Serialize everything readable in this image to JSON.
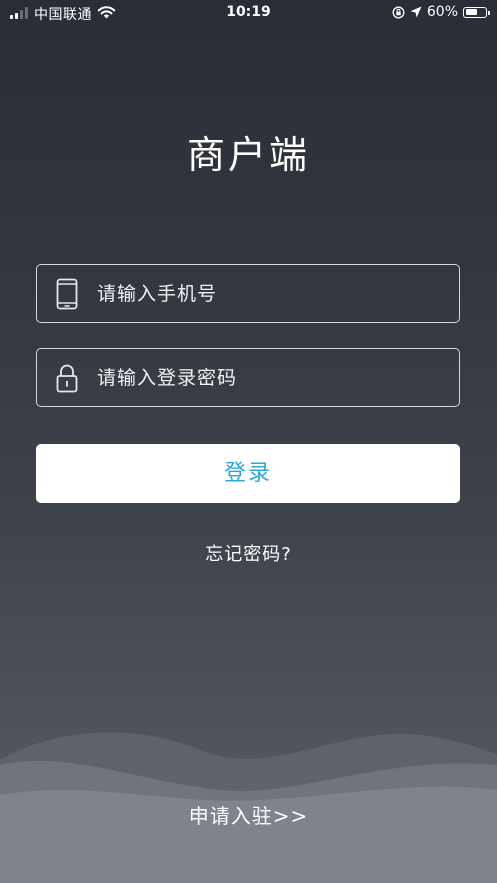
{
  "status_bar": {
    "carrier": "中国联通",
    "time": "10:19",
    "battery_percent": "60%",
    "battery_level": 0.6,
    "signal_bars_active": 2,
    "signal_bars_total": 4
  },
  "title": "商户端",
  "phone_field": {
    "placeholder": "请输入手机号",
    "value": "",
    "icon": "phone-icon"
  },
  "password_field": {
    "placeholder": "请输入登录密码",
    "value": "",
    "icon": "lock-icon"
  },
  "login_button": {
    "label": "登录"
  },
  "forgot_password": {
    "label": "忘记密码?"
  },
  "apply_link": {
    "label": "申请入驻>>"
  },
  "colors": {
    "background_top": "#2a2d36",
    "background_bottom": "#5b5f67",
    "accent": "#2ea7d8",
    "button_background": "#ffffff",
    "field_border": "#d7d8dc"
  }
}
